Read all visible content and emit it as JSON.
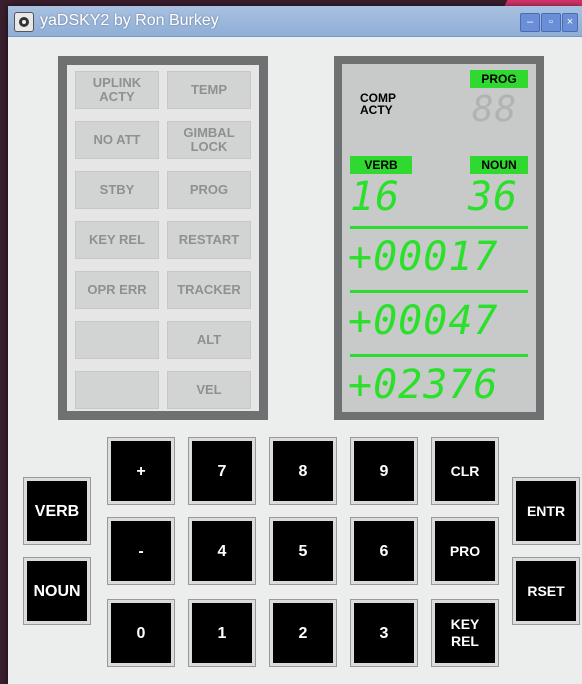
{
  "window": {
    "title": "yaDSKY2 by Ron Burkey",
    "min_glyph": "–",
    "max_glyph": "▫",
    "close_glyph": "×"
  },
  "lamps": {
    "uplink_acty": "UPLINK\nACTY",
    "temp": "TEMP",
    "no_att": "NO ATT",
    "gimbal_lock": "GIMBAL\nLOCK",
    "stby": "STBY",
    "prog": "PROG",
    "key_rel": "KEY REL",
    "restart": "RESTART",
    "opr_err": "OPR ERR",
    "tracker": "TRACKER",
    "blank1": "",
    "alt": "ALT",
    "blank2": "",
    "vel": "VEL"
  },
  "display": {
    "comp_acty": "COMP\nACTY",
    "prog_label": "PROG",
    "prog_value": "88",
    "verb_label": "VERB",
    "noun_label": "NOUN",
    "verb_value": "16",
    "noun_value": "36",
    "r1": "+00017",
    "r2": "+00047",
    "r3": "+02376",
    "colors": {
      "lit": "#2fd92f",
      "segment": "#2be02b",
      "panel": "#6e7171"
    }
  },
  "keys": {
    "verb": "VERB",
    "noun": "NOUN",
    "plus": "+",
    "minus": "-",
    "zero": "0",
    "one": "1",
    "two": "2",
    "three": "3",
    "four": "4",
    "five": "5",
    "six": "6",
    "seven": "7",
    "eight": "8",
    "nine": "9",
    "clr": "CLR",
    "pro": "PRO",
    "key_rel": "KEY\nREL",
    "entr": "ENTR",
    "rset": "RSET"
  }
}
